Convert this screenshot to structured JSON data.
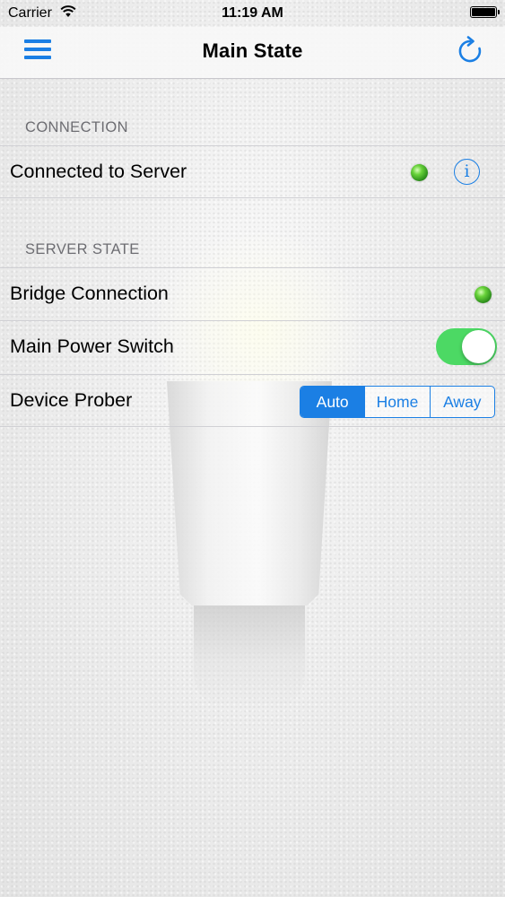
{
  "status_bar": {
    "carrier": "Carrier",
    "time": "11:19 AM"
  },
  "nav": {
    "title": "Main State",
    "menu_icon": "hamburger-menu-icon",
    "refresh_icon": "refresh-icon"
  },
  "sections": {
    "connection": {
      "header": "CONNECTION",
      "rows": [
        {
          "label": "Connected to Server",
          "status": "connected",
          "status_color": "#4cd964"
        }
      ]
    },
    "server_state": {
      "header": "SERVER STATE",
      "bridge": {
        "label": "Bridge Connection",
        "status": "connected",
        "status_color": "#4cd964"
      },
      "power": {
        "label": "Main Power Switch",
        "on": true
      },
      "prober": {
        "label": "Device Prober",
        "options": [
          "Auto",
          "Home",
          "Away"
        ],
        "selected": "Auto"
      }
    }
  },
  "colors": {
    "accent": "#1b7fe4",
    "toggle_on": "#4cd964"
  }
}
